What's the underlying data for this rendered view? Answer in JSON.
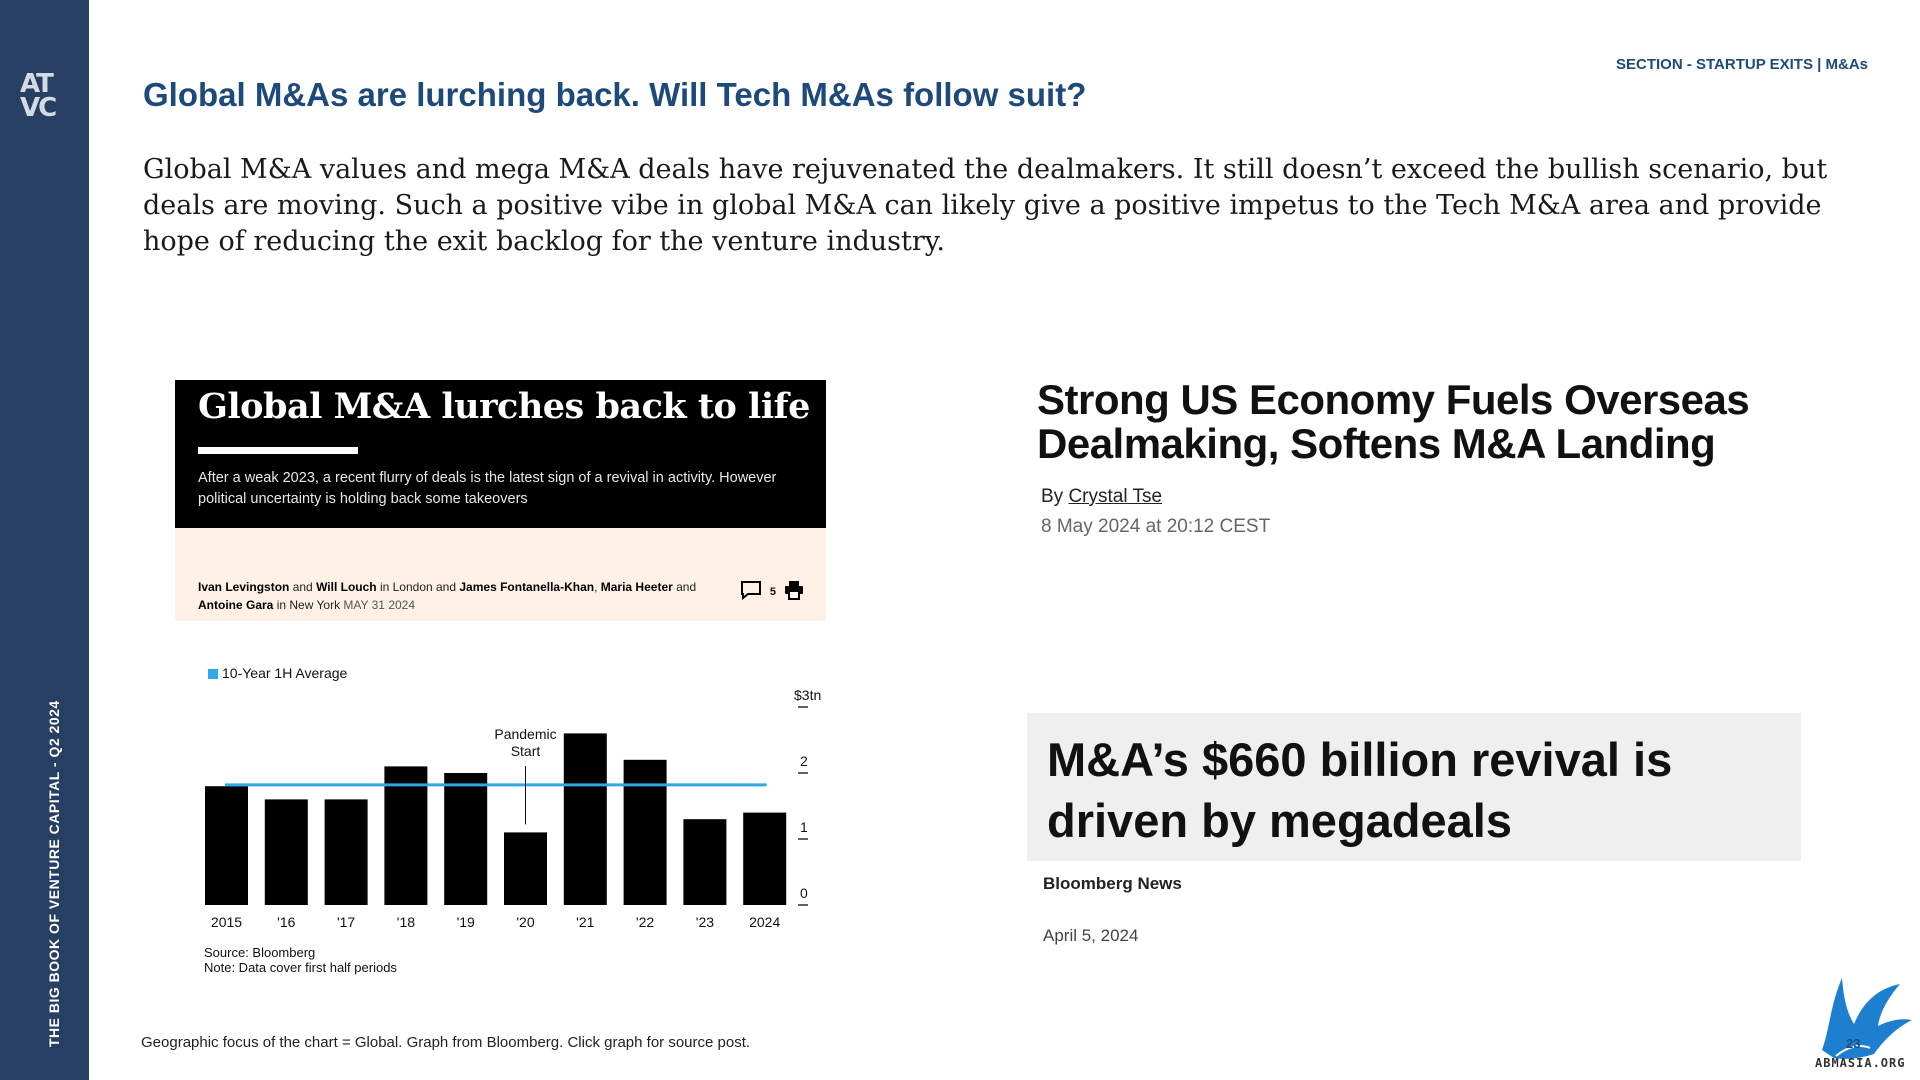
{
  "sidebar": {
    "logo_top": "AT",
    "logo_bottom": "VC",
    "vertical_text": "THE BIG BOOK OF VENTURE CAPITAL - Q2 2024"
  },
  "header": {
    "section_label": "SECTION - STARTUP EXITS | M&As",
    "title": "Global M&As are lurching back. Will Tech M&As follow suit?"
  },
  "intro": "Global M&A values and mega M&A deals have rejuvenated the dealmakers. It still doesn’t exceed the bullish scenario, but deals are moving. Such a positive vibe in global M&A can likely give a positive impetus to the Tech M&A area and provide hope of reducing the exit backlog for the venture industry.",
  "ft_article": {
    "headline": "Global M&A lurches back to life",
    "standfirst": "After a weak 2023, a recent flurry of deals is the latest sign of a revival in activity. However political uncertainty is holding back some takeovers",
    "author1": "Ivan Levingston",
    "and1": " and ",
    "author2": "Will Louch",
    "in_london": " in London and ",
    "author3": "James Fontanella-Khan",
    "comma": ", ",
    "author4": "Maria Heeter",
    "and2": " and ",
    "author5": "Antoine Gara",
    "in_ny": " in New York ",
    "date": "MAY 31 2024",
    "comment_count": "5"
  },
  "chart_data": {
    "type": "bar",
    "categories": [
      "2015",
      "'16",
      "'17",
      "'18",
      "'19",
      "'20",
      "'21",
      "'22",
      "'23",
      "2024"
    ],
    "values": [
      1.8,
      1.6,
      1.6,
      2.1,
      2.0,
      1.1,
      2.6,
      2.2,
      1.3,
      1.4
    ],
    "series_name": "10-Year 1H Average",
    "average": 1.82,
    "y_ticks": [
      "0",
      "1",
      "2",
      "$3tn"
    ],
    "ylim": [
      0,
      3
    ],
    "annotation": "Pandemic Start",
    "annotation_line1": "Pandemic",
    "annotation_line2": "Start",
    "annotation_category_index": 5,
    "source": "Source: Bloomberg",
    "note": "Note: Data cover first half periods",
    "colors": {
      "bars": "#000000",
      "average": "#30a8e8"
    }
  },
  "bloomberg_article": {
    "headline": "Strong US Economy Fuels Overseas Dealmaking, Softens M&A Landing",
    "by": "By ",
    "author": "Crystal Tse",
    "date": "8 May 2024 at 20:12 CEST"
  },
  "megadeals_article": {
    "headline": "M&A’s $660 billion revival is driven by megadeals",
    "source": "Bloomberg News",
    "date": "April 5, 2024"
  },
  "footnote": "Geographic focus of the chart = Global. Graph from Bloomberg. Click graph for source post.",
  "page_number": "23",
  "brand": "ABMASIA.ORG"
}
